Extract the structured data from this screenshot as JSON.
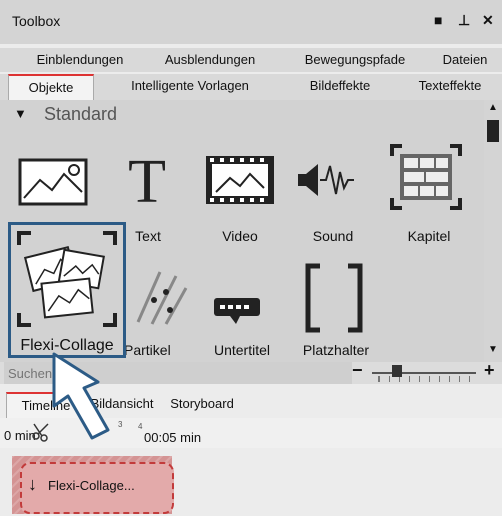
{
  "window": {
    "title": "Toolbox",
    "controls": [
      "■",
      "⊥",
      "✕"
    ]
  },
  "tabs_row1": [
    "Einblendungen",
    "Ausblendungen",
    "Bewegungspfade",
    "Dateien"
  ],
  "tabs_row2": [
    "Objekte",
    "Intelligente Vorlagen",
    "Bildeffekte",
    "Texteffekte"
  ],
  "section": {
    "arrow": "▼",
    "label": "Standard"
  },
  "items": {
    "text": "Text",
    "video": "Video",
    "sound": "Sound",
    "kapitel": "Kapitel",
    "flexi": "Flexi-Collage",
    "partikel": "Partikel",
    "untertitel": "Untertitel",
    "platzhalter": "Platzhalter"
  },
  "search": {
    "placeholder": "Suchen"
  },
  "zoom": {
    "minus": "−",
    "plus": "+"
  },
  "timeline_tabs": [
    "Timeline",
    "Bildansicht",
    "Storyboard"
  ],
  "ruler": {
    "start_label": "0 min",
    "time_label": "00:05 min",
    "ticks": [
      "3",
      "4"
    ]
  },
  "clip": {
    "label": "Flexi-Collage..."
  },
  "colors": {
    "accent": "#2c5b86",
    "tab_active": "#d33333",
    "clip": "#d49494"
  }
}
